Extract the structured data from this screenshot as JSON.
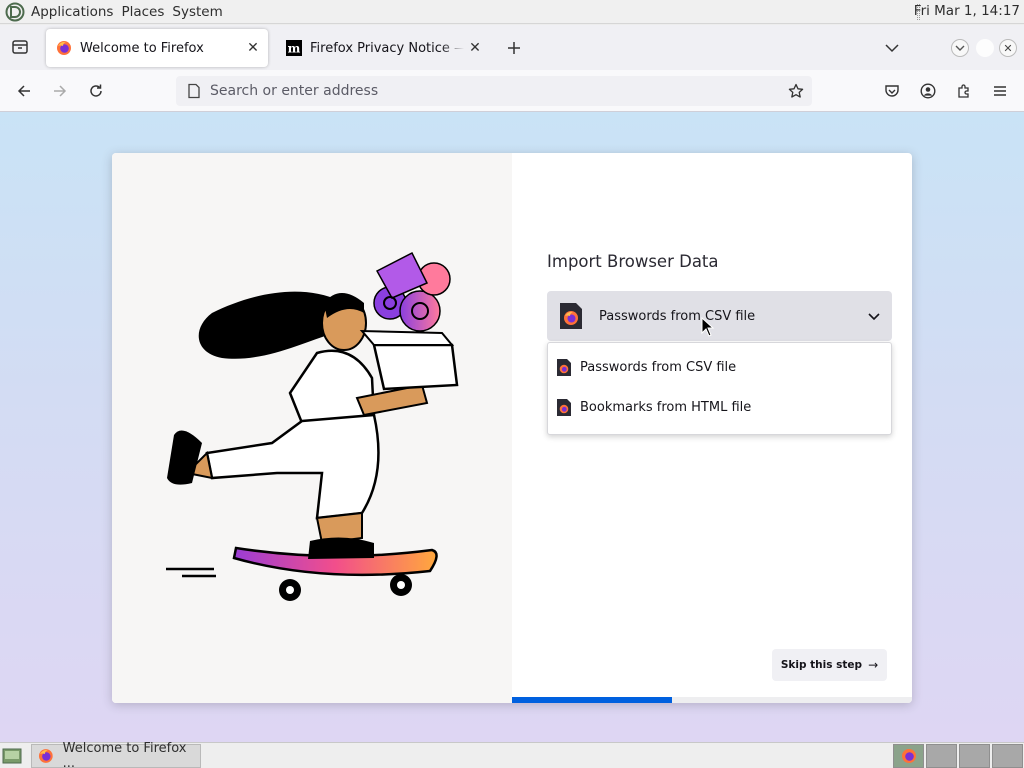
{
  "top_panel": {
    "menus": [
      "Applications",
      "Places",
      "System"
    ],
    "clock": "Fri Mar  1, 14:17"
  },
  "tabs": [
    {
      "title": "Welcome to Firefox",
      "active": true
    },
    {
      "title": "Firefox Privacy Notice — Mozilla",
      "active": false
    }
  ],
  "navbar": {
    "url_placeholder": "Search or enter address"
  },
  "content": {
    "heading": "Import Browser Data",
    "select_value": "Passwords from CSV file",
    "options": [
      "Passwords from CSV file",
      "Bookmarks from HTML file"
    ],
    "skip_button": "Skip this step",
    "skip_arrow": "→",
    "progress_fraction": 0.4
  },
  "taskbar": {
    "task_title": "Welcome to Firefox ..."
  },
  "colors": {
    "accent": "#0060df",
    "page_gradient_top": "#c9e3f6",
    "page_gradient_bottom": "#ded6f3"
  }
}
